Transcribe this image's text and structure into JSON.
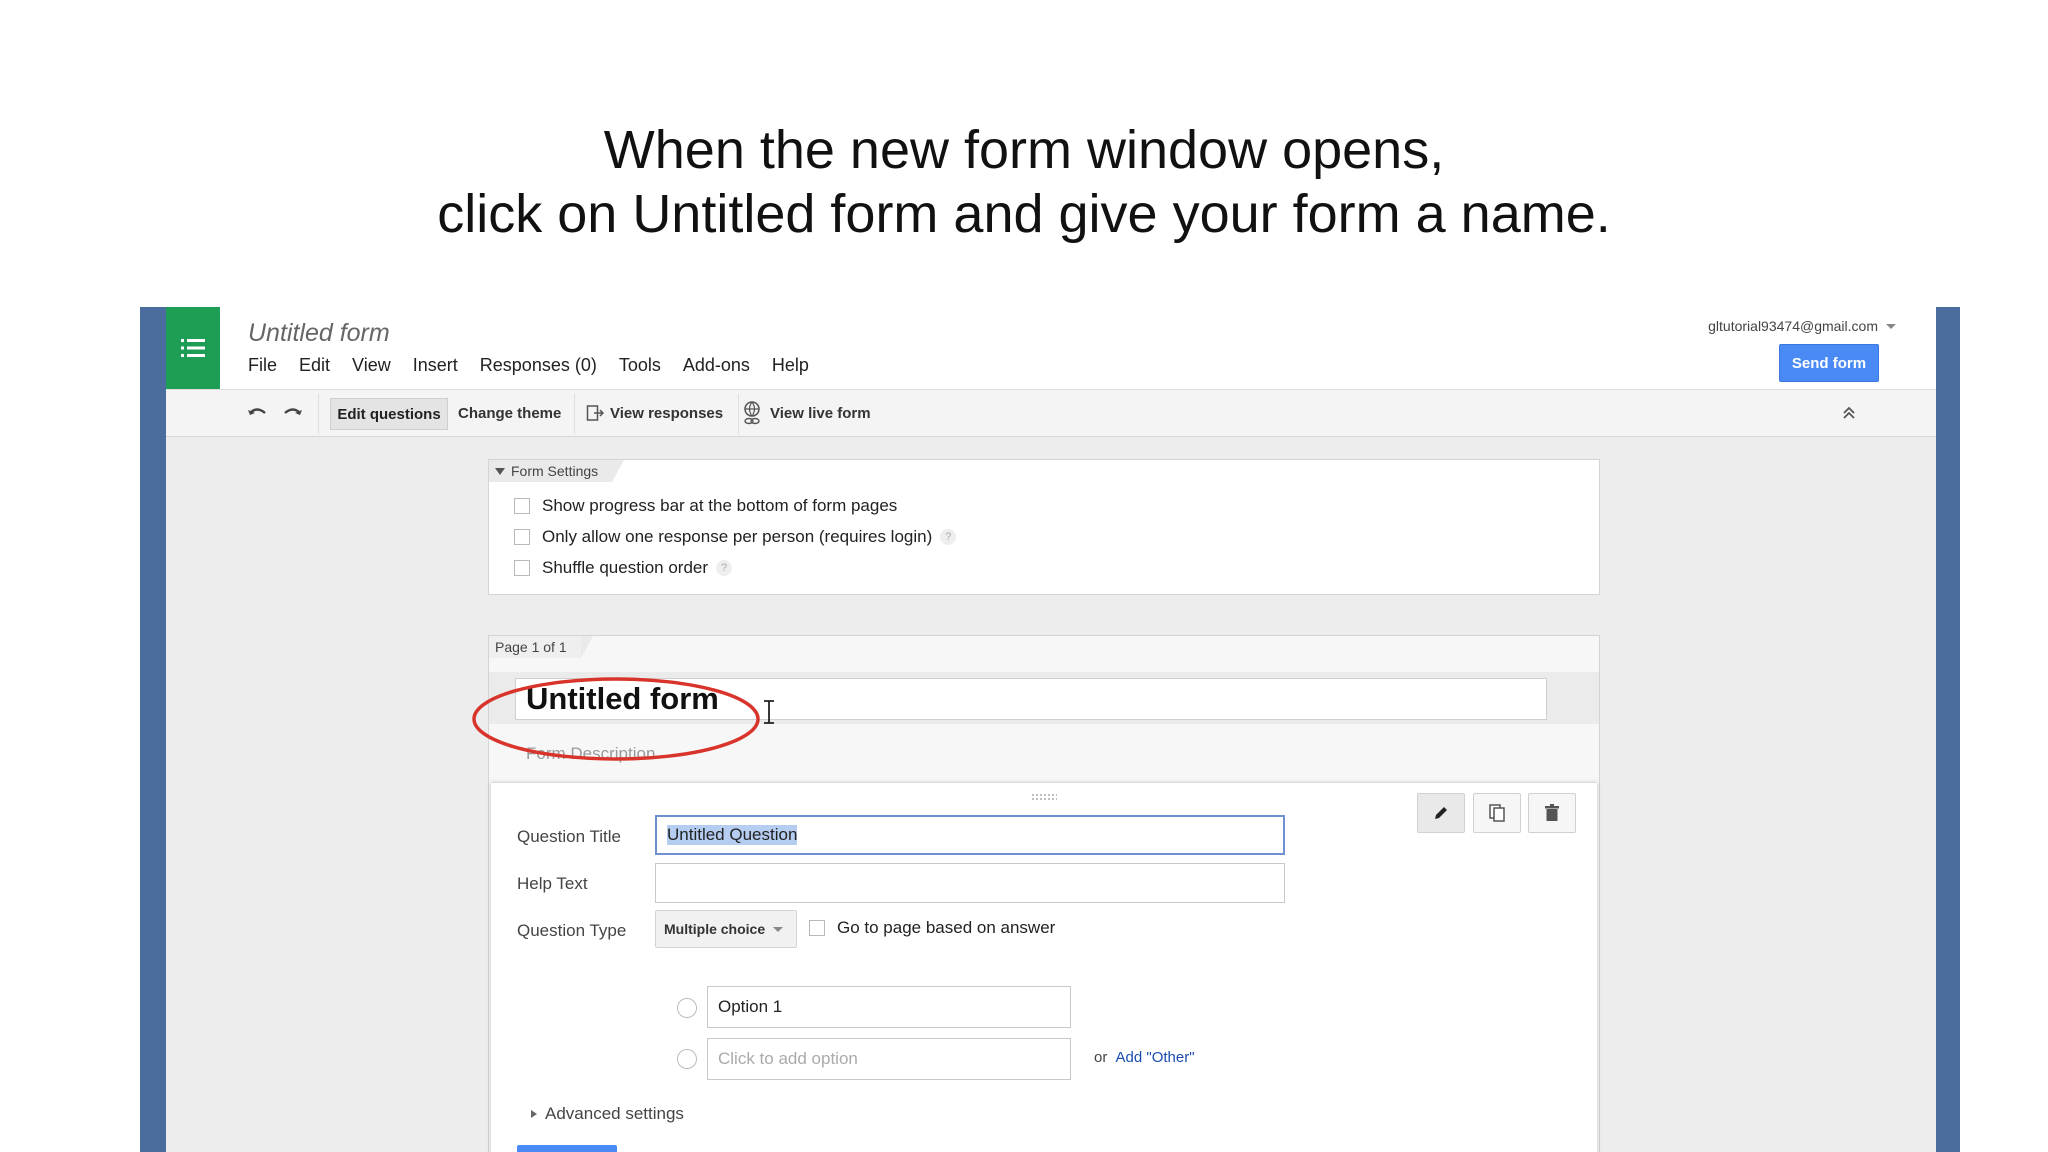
{
  "caption": {
    "line1": "When the new form window opens,",
    "line2": "click on Untitled form and give your form a name."
  },
  "header": {
    "doc_title": "Untitled form",
    "account_email": "gltutorial93474@gmail.com",
    "send_label": "Send form",
    "menu": [
      "File",
      "Edit",
      "View",
      "Insert",
      "Responses (0)",
      "Tools",
      "Add-ons",
      "Help"
    ]
  },
  "toolbar": {
    "edit_questions": "Edit questions",
    "change_theme": "Change theme",
    "view_responses": "View responses",
    "view_live_form": "View live form"
  },
  "form_settings": {
    "tab_label": "Form Settings",
    "options": [
      {
        "label": "Show progress bar at the bottom of form pages",
        "checked": false
      },
      {
        "label": "Only allow one response per person (requires login)",
        "checked": false
      },
      {
        "label": "Shuffle question order",
        "checked": false
      }
    ]
  },
  "page": {
    "tab_label": "Page 1 of 1",
    "form_title": "Untitled form",
    "form_description_placeholder": "Form Description"
  },
  "question": {
    "title_label": "Question Title",
    "title_value": "Untitled Question",
    "help_label": "Help Text",
    "help_value": "",
    "type_label": "Question Type",
    "type_value": "Multiple choice",
    "go_to_page_label": "Go to page based on answer",
    "option1": "Option 1",
    "add_option_placeholder": "Click to add option",
    "or_text": "or",
    "add_other": "Add \"Other\"",
    "advanced_settings": "Advanced settings"
  },
  "colors": {
    "accent_blue": "#4a8af4",
    "logo_green": "#1e9e55",
    "highlight_ellipse": "#d9342b",
    "frame_blue": "#4a6d9e"
  }
}
